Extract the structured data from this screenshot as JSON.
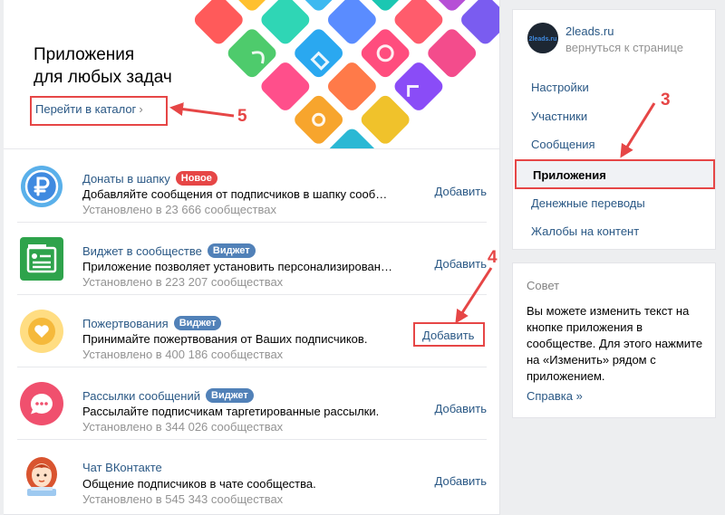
{
  "banner": {
    "title_line1": "Приложения",
    "title_line2": "для любых задач",
    "catalog_link": "Перейти в каталог",
    "catalog_chevron": "›"
  },
  "apps": [
    {
      "title": "Донаты в шапку",
      "badge": "Новое",
      "badge_color": "#e64646",
      "description": "Добавляйте сообщения от подписчиков в шапку сообщества",
      "installed": "Установлено в 23 666 сообществах",
      "add_label": "Добавить",
      "icon": "ruble-icon",
      "icon_color": "#3f8ae0"
    },
    {
      "title": "Виджет в сообществе",
      "badge": "Виджет",
      "badge_color": "#5181b8",
      "description": "Приложение позволяет установить персонализированный виджет",
      "installed": "Установлено в 223 207 сообществах",
      "add_label": "Добавить",
      "icon": "widget-icon",
      "icon_color": "#2ea34b"
    },
    {
      "title": "Пожертвования",
      "badge": "Виджет",
      "badge_color": "#5181b8",
      "description": "Принимайте пожертвования от Ваших подписчиков.",
      "installed": "Установлено в 400 186 сообществах",
      "add_label": "Добавить",
      "icon": "heart-icon",
      "icon_color": "#f5c344"
    },
    {
      "title": "Рассылки сообщений",
      "badge": "Виджет",
      "badge_color": "#5181b8",
      "description": "Рассылайте подписчикам таргетированные рассылки.",
      "installed": "Установлено в 344 026 сообществах",
      "add_label": "Добавить",
      "icon": "chat-bubble-icon",
      "icon_color": "#f0506e"
    },
    {
      "title": "Чат ВКонтакте",
      "badge": "",
      "badge_color": "",
      "description": "Общение подписчиков в чате сообщества.",
      "installed": "Установлено в 545 343 сообществах",
      "add_label": "Добавить",
      "icon": "chat-avatar-icon",
      "icon_color": "#d9542f"
    }
  ],
  "sidebar": {
    "group_name": "2leads.ru",
    "group_avatar_text": "2leads.ru",
    "back_link": "вернуться к странице",
    "menu": [
      "Настройки",
      "Участники",
      "Сообщения",
      "Приложения",
      "Денежные переводы",
      "Жалобы на контент"
    ],
    "active_index": 3
  },
  "tip": {
    "title": "Совет",
    "text": "Вы можете изменить текст на кнопке приложения в сообществе. Для этого нажмите на «Изменить» рядом с приложением.",
    "link": "Справка »"
  },
  "annotations": {
    "step3": "3",
    "step4": "4",
    "step5": "5",
    "color": "#e64646"
  }
}
